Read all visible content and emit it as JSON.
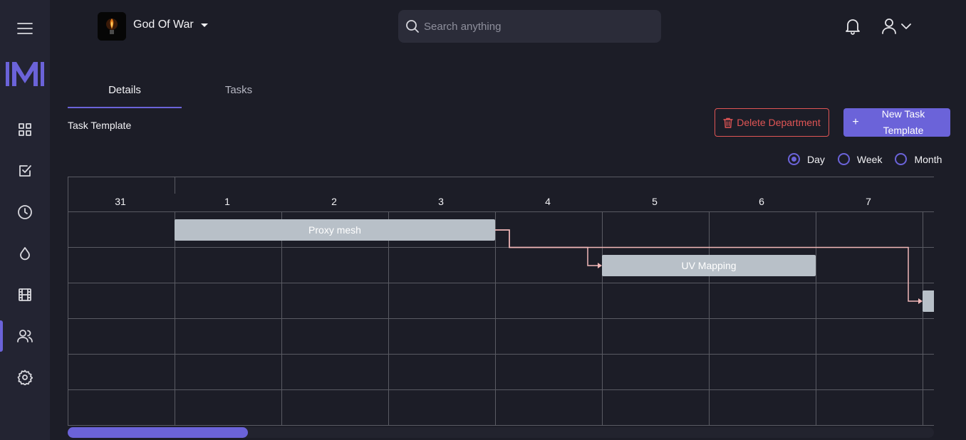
{
  "sidebar": {
    "items": [
      {
        "name": "menu-icon"
      },
      {
        "name": "logo"
      },
      {
        "name": "dashboard-icon"
      },
      {
        "name": "tasks-check-icon"
      },
      {
        "name": "clock-icon"
      },
      {
        "name": "drop-icon"
      },
      {
        "name": "film-icon"
      },
      {
        "name": "users-icon",
        "active": true
      },
      {
        "name": "settings-icon"
      }
    ],
    "accent": "#6b63d9"
  },
  "header": {
    "project_name": "God Of War",
    "search_placeholder": "Search anything"
  },
  "tabs": [
    {
      "label": "Details",
      "active": true
    },
    {
      "label": "Tasks",
      "active": false
    }
  ],
  "section": {
    "title": "Task Template",
    "delete_label": "Delete Department",
    "new_label": "New Task Template"
  },
  "view_options": [
    {
      "label": "Day",
      "selected": true
    },
    {
      "label": "Week",
      "selected": false
    },
    {
      "label": "Month",
      "selected": false
    }
  ],
  "gantt": {
    "days": [
      "31",
      "1",
      "2",
      "3",
      "4",
      "5",
      "6",
      "7"
    ],
    "tasks": [
      {
        "name": "Proxy mesh",
        "start_day": "1",
        "end_day": "3",
        "row": 1
      },
      {
        "name": "UV Mapping",
        "start_day": "5",
        "end_day": "6",
        "row": 2
      },
      {
        "name": "",
        "start_day": "8",
        "end_day": "8",
        "row": 3
      }
    ],
    "bar_color": "#b8c0c8",
    "link_color": "#f2b8b8"
  }
}
